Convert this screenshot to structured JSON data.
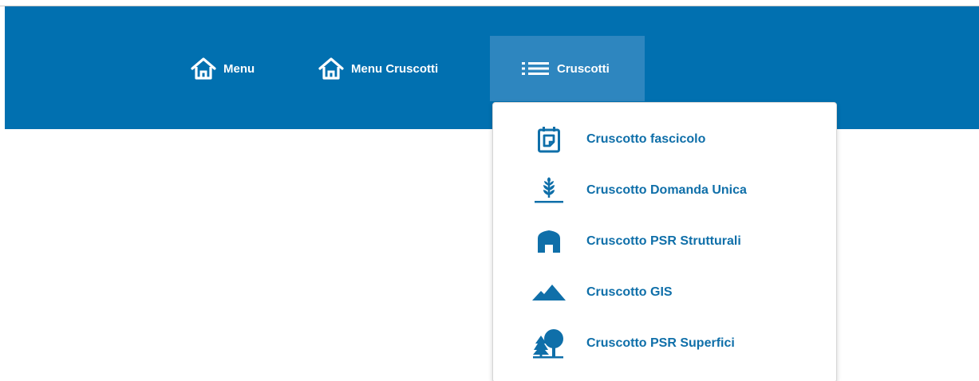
{
  "navbar": {
    "background": "#0170b0",
    "active_background": "#2e86bf",
    "items": [
      {
        "label": "Menu",
        "icon": "home-icon"
      },
      {
        "label": "Menu Cruscotti",
        "icon": "home-icon"
      },
      {
        "label": "Cruscotti",
        "icon": "list-icon",
        "active": true
      }
    ]
  },
  "dropdown": {
    "accent": "#0f6fa9",
    "items": [
      {
        "label": "Cruscotto fascicolo",
        "icon": "calendar-note-icon"
      },
      {
        "label": "Cruscotto Domanda Unica",
        "icon": "wheat-icon"
      },
      {
        "label": "Cruscotto PSR Strutturali",
        "icon": "building-icon"
      },
      {
        "label": "Cruscotto GIS",
        "icon": "mountains-icon"
      },
      {
        "label": "Cruscotto PSR Superfici",
        "icon": "trees-icon"
      }
    ]
  }
}
